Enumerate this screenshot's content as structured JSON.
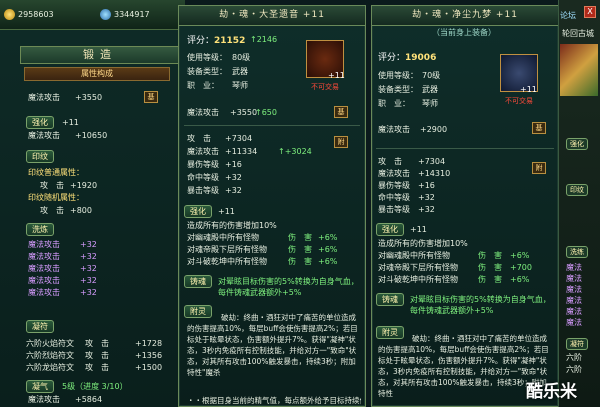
{
  "resources": {
    "gold": "2958603",
    "gems": "3344917"
  },
  "forge": {
    "title": "锻造",
    "attr_header": "属性构成",
    "magic_attack_label": "魔法攻击",
    "magic_attack_val": "+3550",
    "base_label": "基",
    "enhance_label": "强化",
    "enhance_val": "+11",
    "enhance_attack_label": "魔法攻击",
    "enhance_attack_val": "+10650",
    "seal_label": "印纹",
    "seal_common": "印纹普通属性：",
    "seal_attack_label": "攻　击",
    "seal_attack_val": "+1920",
    "seal_random": "印纹随机属性：",
    "seal_random_label": "攻　击",
    "seal_random_val": "+800",
    "wash_label": "洗炼",
    "wash_rows": [
      {
        "label": "魔法攻击",
        "val": "+32"
      },
      {
        "label": "魔法攻击",
        "val": "+32"
      },
      {
        "label": "魔法攻击",
        "val": "+32"
      },
      {
        "label": "魔法攻击",
        "val": "+32"
      },
      {
        "label": "魔法攻击",
        "val": "+32"
      }
    ],
    "rune_label": "凝符",
    "rune_rows": [
      {
        "label": "六阶火焰符文",
        "stat": "攻　击",
        "val": "+1728"
      },
      {
        "label": "六阶烈焰符文",
        "stat": "攻　击",
        "val": "+1356"
      },
      {
        "label": "六阶龙焰符文",
        "stat": "攻　击",
        "val": "+1500"
      }
    ],
    "cond_label": "凝气",
    "cond_text": "5级（进度 3/10）",
    "cond_attack_label": "魔法攻击",
    "cond_attack_val": "+5864"
  },
  "item1": {
    "title": "劫・魂・大圣遗音 +11",
    "score_label": "评分：",
    "score": "21152",
    "score_delta": "2146",
    "level_label": "使用等级：",
    "level": "80级",
    "type_label": "装备类型：",
    "type": "武器",
    "job_label": "职　业：",
    "job": "琴师",
    "untradeable": "不可交易",
    "item_level": "+11",
    "magic_label": "魔法攻击",
    "magic_val": "+3550",
    "magic_delta": "650",
    "base_label": "基",
    "stats": [
      {
        "label": "攻　击",
        "val": "+7304"
      },
      {
        "label": "魔法攻击",
        "val": "+11334",
        "delta": "+3024"
      },
      {
        "label": "暴伤等级",
        "val": "+16"
      },
      {
        "label": "命中等级",
        "val": "+32"
      },
      {
        "label": "暴击等级",
        "val": "+32"
      }
    ],
    "attach_label": "附",
    "enhance_label": "强化",
    "enhance_val": "+11",
    "enh_line": "造成所有的伤害增加10%",
    "enh_rows": [
      {
        "label": "对幽魂殿中所有怪物",
        "stat": "伤　害",
        "val": "+6%"
      },
      {
        "label": "对魂帝殿下层所有怪物",
        "stat": "伤　害",
        "val": "+6%"
      },
      {
        "label": "对斗破乾坤中所有怪物",
        "stat": "伤　害",
        "val": "+6%"
      }
    ],
    "cast_label": "铸魂",
    "cast_text": "对晕眩目标伤害的5%转换为自身气血，每件铸魂武器额外+5%",
    "spirit_label": "附灵",
    "spirit_text": "破劫：终曲・酒狂对中了痛苦的单位造成的伤害提高10%，每层buff会使伤害提高2%；若目标处于眩晕状态，伤害额外提升7%。获得\"凝神\"状态，3秒内免疫所有控制技能，并给对方一\"致命\"状态，对其所有攻击100%触发暴击，持续3秒；附加特性\"魔杀",
    "spirit_text2": "・・根据目身当前的精气值，每点额外给予目标持续伤害，持续3秒，"
  },
  "item2": {
    "title": "劫・魂・净尘九梦 +11",
    "equipped": "（当前身上装备）",
    "score_label": "评分：",
    "score": "19006",
    "level_label": "使用等级：",
    "level": "70级",
    "type_label": "装备类型：",
    "type": "武器",
    "job_label": "职　业：",
    "job": "琴师",
    "untradeable": "不可交易",
    "item_level": "+11",
    "magic_label": "魔法攻击",
    "magic_val": "+2900",
    "base_label": "基",
    "stats": [
      {
        "label": "攻　击",
        "val": "+7304"
      },
      {
        "label": "魔法攻击",
        "val": "+14310"
      },
      {
        "label": "暴伤等级",
        "val": "+16"
      },
      {
        "label": "命中等级",
        "val": "+32"
      },
      {
        "label": "暴击等级",
        "val": "+32"
      }
    ],
    "attach_label": "附",
    "enhance_label": "强化",
    "enhance_val": "+11",
    "enh_line": "造成所有的伤害增加10%",
    "enh_rows": [
      {
        "label": "对幽魂殿中所有怪物",
        "stat": "伤　害",
        "val": "+6%"
      },
      {
        "label": "对魂帝殿下层所有怪物",
        "stat": "伤　害",
        "val": "+700"
      },
      {
        "label": "对斗破乾坤中所有怪物",
        "stat": "伤　害",
        "val": "+6%"
      }
    ],
    "cast_label": "铸魂",
    "cast_text": "对晕眩目标伤害的5%转换为自身气血，每件铸魂武器额外+5%",
    "spirit_label": "附灵",
    "spirit_text": "破劫：终曲・酒狂对中了痛苦的单位造成的伤害提高10%，每层buff会使伤害提高2%；若目标处于眩晕状态，伤害额外提升7%。获得\"凝神\"状态，3秒内免疫所有控制技能，并给对方一\"致命\"状态，对其所有攻击100%触发暴击，持续3秒；附加特性"
  },
  "side": {
    "top_link": "论坛",
    "close_icon": "X",
    "area": "轮回古城",
    "tags": [
      "强化",
      "印纹",
      "洗练",
      "凝符"
    ],
    "wash_rows": [
      "魔法",
      "魔法",
      "魔法",
      "魔法",
      "魔法",
      "魔法"
    ],
    "rune_rows": [
      "六阶",
      "六阶"
    ],
    "bottom": "魔法"
  },
  "watermark": "酷乐米"
}
